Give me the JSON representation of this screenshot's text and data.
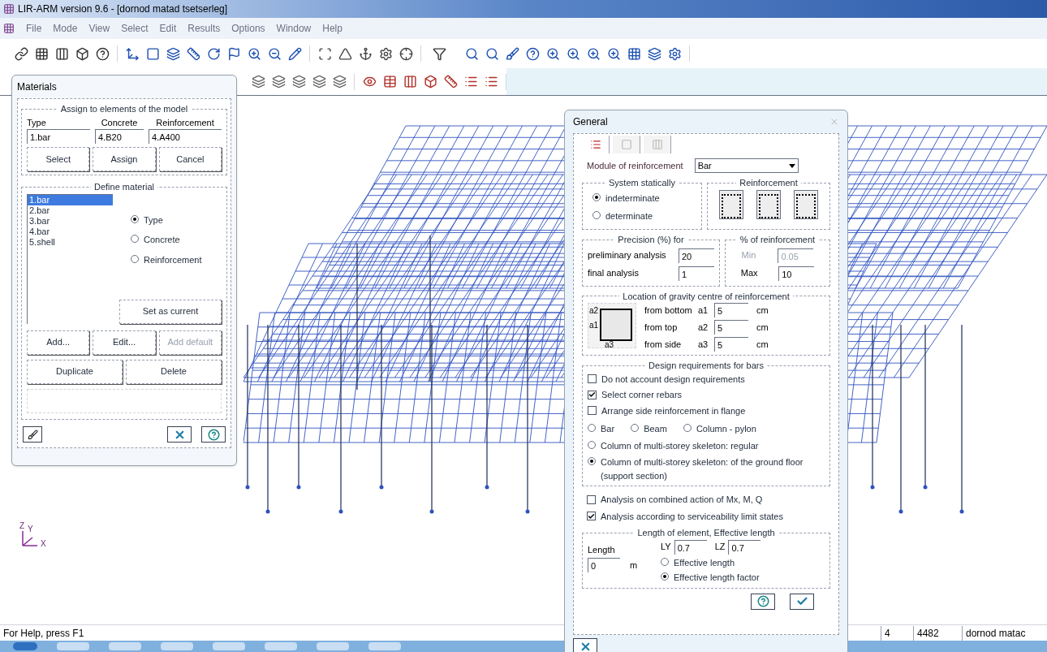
{
  "window": {
    "title": "LIR-ARM version 9.6 - [dornod matad tsetserleg]"
  },
  "menu": [
    "File",
    "Mode",
    "View",
    "Select",
    "Edit",
    "Results",
    "Options",
    "Window",
    "Help"
  ],
  "axes": {
    "z": "Z",
    "y": "Y",
    "x": "X"
  },
  "materials": {
    "title": "Materials",
    "assign_group": "Assign to elements of the model",
    "columns": [
      {
        "label": "Type",
        "value": "1.bar"
      },
      {
        "label": "Concrete",
        "value": "4.B20"
      },
      {
        "label": "Reinforcement",
        "value": "4.A400"
      }
    ],
    "buttons": [
      "Select",
      "Assign",
      "Cancel"
    ],
    "define_group": "Define material",
    "list": [
      {
        "label": "1.bar",
        "selected": true
      },
      {
        "label": "2.bar",
        "selected": false
      },
      {
        "label": "3.bar",
        "selected": false
      },
      {
        "label": "4.bar",
        "selected": false
      },
      {
        "label": "5.shell",
        "selected": false
      }
    ],
    "radios": [
      {
        "label": "Type",
        "selected": true
      },
      {
        "label": "Concrete",
        "selected": false
      },
      {
        "label": "Reinforcement",
        "selected": false
      }
    ],
    "set_current": "Set as current",
    "actions": [
      {
        "label": "Add...",
        "disabled": false
      },
      {
        "label": "Edit...",
        "disabled": false
      },
      {
        "label": "Add default",
        "disabled": true
      }
    ],
    "actions2": [
      "Duplicate",
      "Delete"
    ]
  },
  "general": {
    "title": "General",
    "tabs": [
      {
        "selected": true
      },
      {
        "selected": false
      },
      {
        "selected": false
      }
    ],
    "module": {
      "label": "Module of reinforcement",
      "value": "Bar"
    },
    "system": {
      "title": "System statically",
      "options": [
        {
          "label": "indeterminate",
          "selected": true
        },
        {
          "label": "determinate",
          "selected": false
        }
      ]
    },
    "reinforcement_title": "Reinforcement",
    "precision": {
      "title": "Precision (%) for",
      "rows": [
        {
          "label": "preliminary analysis",
          "value": "20"
        },
        {
          "label": "final analysis",
          "value": "1"
        }
      ]
    },
    "percent": {
      "title": "% of reinforcement",
      "rows": [
        {
          "label": "Min",
          "value": "0.05",
          "disabled": true
        },
        {
          "label": "Max",
          "value": "10",
          "disabled": false
        }
      ]
    },
    "gravity": {
      "title": "Location of gravity centre of reinforcement",
      "labels": [
        "a2",
        "a1",
        "a3"
      ],
      "rows": [
        {
          "label": "from bottom",
          "symbol": "a1",
          "value": "5",
          "unit": "cm"
        },
        {
          "label": "from top",
          "symbol": "a2",
          "value": "5",
          "unit": "cm"
        },
        {
          "label": "from side",
          "symbol": "a3",
          "value": "5",
          "unit": "cm"
        }
      ]
    },
    "design": {
      "title": "Design requirements for bars",
      "checks": [
        {
          "label": "Do not account design requirements",
          "checked": false
        },
        {
          "label": "Select corner rebars",
          "checked": true
        },
        {
          "label": "Arrange side reinforcement in flange",
          "checked": false
        }
      ],
      "options": [
        {
          "label": "Bar",
          "selected": false
        },
        {
          "label": "Beam",
          "selected": false
        },
        {
          "label": "Column - pylon",
          "selected": false
        },
        {
          "label": "Column of multi-storey skeleton: regular",
          "selected": false
        },
        {
          "label": "Column of multi-storey skeleton: of the ground floor (support section)",
          "selected": true
        }
      ]
    },
    "checks": [
      {
        "label": "Analysis on combined action of Mx, M, Q",
        "checked": false
      },
      {
        "label": "Analysis according to serviceability limit states",
        "checked": true
      }
    ],
    "length": {
      "title": "Length of element,  Effective length",
      "label": "Length",
      "value": "0",
      "unit": "m",
      "ly_label": "LY",
      "ly": "0.7",
      "lz_label": "LZ",
      "lz": "0.7",
      "options": [
        {
          "label": "Effective length",
          "selected": false
        },
        {
          "label": "Effective length factor",
          "selected": true
        }
      ]
    }
  },
  "status_bar": {
    "help": "For Help, press F1",
    "cells": [
      "4",
      "4482",
      "dornod matac"
    ]
  }
}
